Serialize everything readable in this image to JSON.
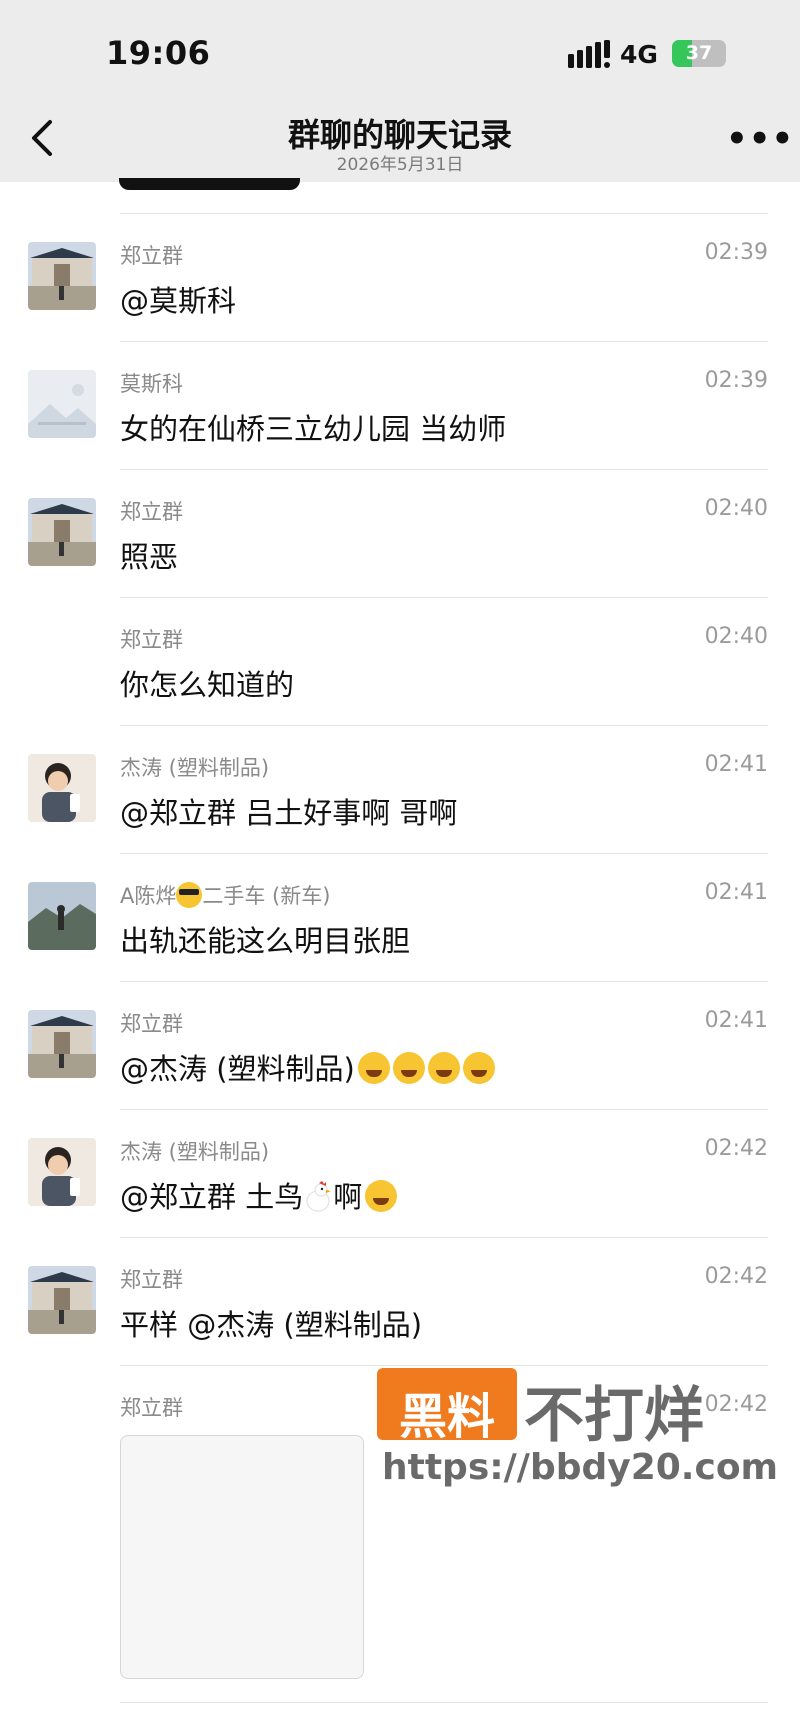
{
  "status": {
    "time": "19:06",
    "network": "4G",
    "battery": "37",
    "battery_level_percent": 37
  },
  "nav": {
    "title": "群聊的聊天记录",
    "date": "2026年5月31日",
    "more": "•••"
  },
  "messages": [
    {
      "sender": "郑立群",
      "time": "02:39",
      "text": "@莫斯科",
      "avatar": "gate-photo"
    },
    {
      "sender": "莫斯科",
      "time": "02:39",
      "text": "女的在仙桥三立幼儿园 当幼师",
      "avatar": "placeholder-image"
    },
    {
      "sender": "郑立群",
      "time": "02:40",
      "text": "照恶",
      "avatar": "gate-photo"
    },
    {
      "sender": "郑立群",
      "time": "02:40",
      "text": "你怎么知道的",
      "avatar": "none"
    },
    {
      "sender": "杰涛 (塑料制品)",
      "time": "02:41",
      "text": "@郑立群 吕土好事啊 哥啊",
      "avatar": "child-photo"
    },
    {
      "sender": "A陈烨",
      "sender_suffix": "二手车 (新车)",
      "time": "02:41",
      "text": "出轨还能这么明目张胆",
      "avatar": "mountain-photo"
    },
    {
      "sender": "郑立群",
      "time": "02:41",
      "text": "@杰涛 (塑料制品)",
      "avatar": "gate-photo"
    },
    {
      "sender": "杰涛 (塑料制品)",
      "time": "02:42",
      "text": "@郑立群 土鸟",
      "text_after": "啊",
      "avatar": "child-photo"
    },
    {
      "sender": "郑立群",
      "time": "02:42",
      "text": "平样 @杰涛 (塑料制品)",
      "avatar": "gate-photo"
    },
    {
      "sender": "郑立群",
      "time": "02:42",
      "avatar": "none"
    }
  ],
  "watermark": {
    "badge": "黑料",
    "main": "不打烊",
    "url": "https://bbdy20.com"
  },
  "colors": {
    "topbar": "#ececec",
    "battery_green": "#35c759",
    "watermark_orange": "#f07a1e"
  }
}
